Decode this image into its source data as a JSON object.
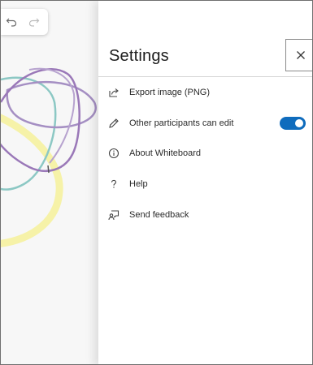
{
  "toolbar": {
    "undo_icon": "undo-icon",
    "redo_icon": "redo-icon"
  },
  "settings": {
    "title": "Settings",
    "close_icon": "close-icon",
    "items": [
      {
        "label": "Export image (PNG)",
        "icon": "export-icon"
      },
      {
        "label": "Other participants can edit",
        "icon": "pencil-icon",
        "toggle_on": true
      },
      {
        "label": "About Whiteboard",
        "icon": "info-icon"
      },
      {
        "label": "Help",
        "icon": "question-icon"
      },
      {
        "label": "Send feedback",
        "icon": "feedback-icon"
      }
    ]
  },
  "colors": {
    "accent": "#0f6cbd",
    "ink_purple": "#9a78b8",
    "ink_teal": "#8cc8c4",
    "ink_yellow": "#f6f2a8"
  }
}
